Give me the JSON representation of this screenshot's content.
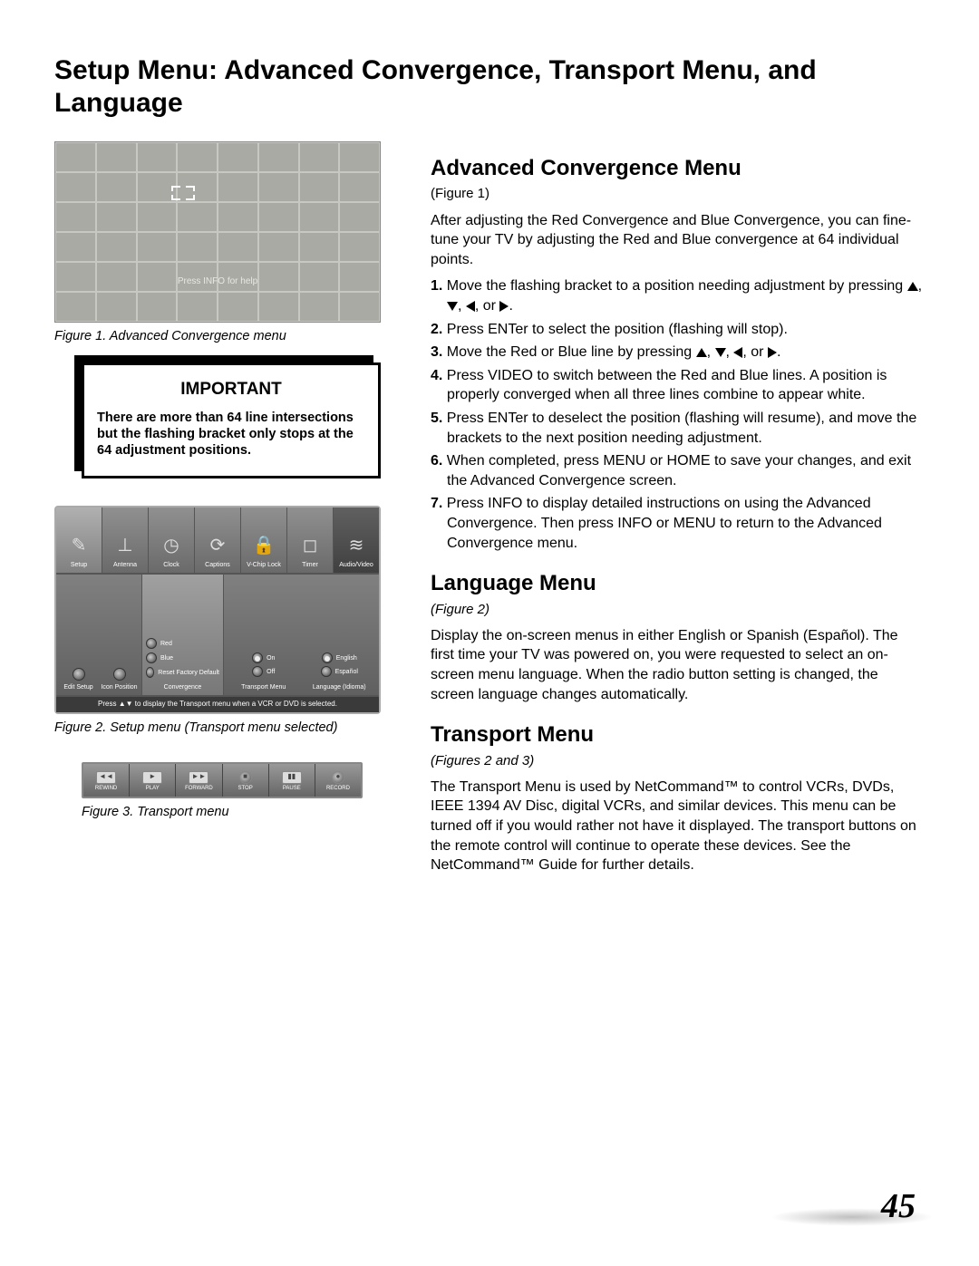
{
  "page_title": "Setup Menu: Advanced Convergence, Transport Menu, and Language",
  "page_number": "45",
  "figure1": {
    "help_text": "Press INFO for help",
    "caption": "Figure 1. Advanced Convergence menu"
  },
  "important": {
    "title": "IMPORTANT",
    "text": "There are more than 64 line intersections but the flashing bracket only stops at the 64 adjustment positions."
  },
  "figure2": {
    "top_icons": [
      {
        "label": "Setup",
        "glyph": "✎"
      },
      {
        "label": "Antenna",
        "glyph": "⊥"
      },
      {
        "label": "Clock",
        "glyph": "◷"
      },
      {
        "label": "Captions",
        "glyph": "⟳"
      },
      {
        "label": "V-Chip Lock",
        "glyph": "🔒"
      },
      {
        "label": "Timer",
        "glyph": "◻"
      },
      {
        "label": "Audio/Video",
        "glyph": "≋"
      }
    ],
    "mid_left": [
      "Edit Setup",
      "Icon Position"
    ],
    "convergence": {
      "label": "Convergence",
      "items": [
        "Red",
        "Blue",
        "Reset Factory Default"
      ]
    },
    "transport": {
      "label": "Transport Menu",
      "opts": [
        "On",
        "Off"
      ]
    },
    "language": {
      "label": "Language (Idioma)",
      "opts": [
        "English",
        "Español"
      ]
    },
    "bottom": "Press ▲▼ to display the Transport menu when a VCR or DVD is selected.",
    "caption": "Figure 2.  Setup menu (Transport menu selected)"
  },
  "figure3": {
    "buttons": [
      "REWIND",
      "PLAY",
      "FORWARD",
      "STOP",
      "PAUSE",
      "RECORD"
    ],
    "glyphs": [
      "◄◄",
      "►",
      "►►",
      "■",
      "▮▮",
      "●"
    ],
    "caption": "Figure 3.  Transport menu"
  },
  "sections": {
    "advanced": {
      "heading": "Advanced Convergence Menu",
      "ref": "(Figure 1)",
      "intro": "After adjusting the Red Convergence and Blue Convergence, you can fine-tune your TV by adjusting the Red and Blue convergence at 64 individual points.",
      "steps": [
        {
          "n": "1.",
          "pre": "Move the flashing bracket to a position needing adjustment by pressing ",
          "post": "."
        },
        {
          "n": "2.",
          "t": "Press ENTer to select the position (flashing will stop)."
        },
        {
          "n": "3.",
          "pre": "Move the Red or Blue line by pressing ",
          "post": "."
        },
        {
          "n": "4.",
          "t": "Press VIDEO to switch between the Red and Blue lines.  A position is properly converged when all three lines combine to appear white."
        },
        {
          "n": "5.",
          "t": "Press ENTer to deselect the position (flashing will resume), and move the brackets to the next position needing adjustment."
        },
        {
          "n": "6.",
          "t": "When completed, press MENU or HOME to save your changes, and exit the Advanced Convergence screen."
        },
        {
          "n": "7.",
          "t": "Press INFO to display detailed instructions on using the Advanced Convergence.  Then press INFO or MENU to return to the Advanced Convergence menu."
        }
      ]
    },
    "language": {
      "heading": "Language Menu",
      "ref": "(Figure 2)",
      "text": "Display the on-screen menus in either English or Spanish (Español).  The first time your TV was powered on, you were requested to select an on-screen menu language.  When the radio button setting is changed, the screen language changes automatically."
    },
    "transport": {
      "heading": "Transport Menu",
      "ref": "(Figures 2 and 3)",
      "text": "The Transport Menu is used by NetCommand™ to control VCRs, DVDs, IEEE 1394 AV Disc, digital VCRs, and similar devices.  This menu can be turned off if you would rather not have it displayed.  The transport buttons on the remote control will continue to operate these devices.  See the NetCommand™ Guide for further details."
    }
  }
}
